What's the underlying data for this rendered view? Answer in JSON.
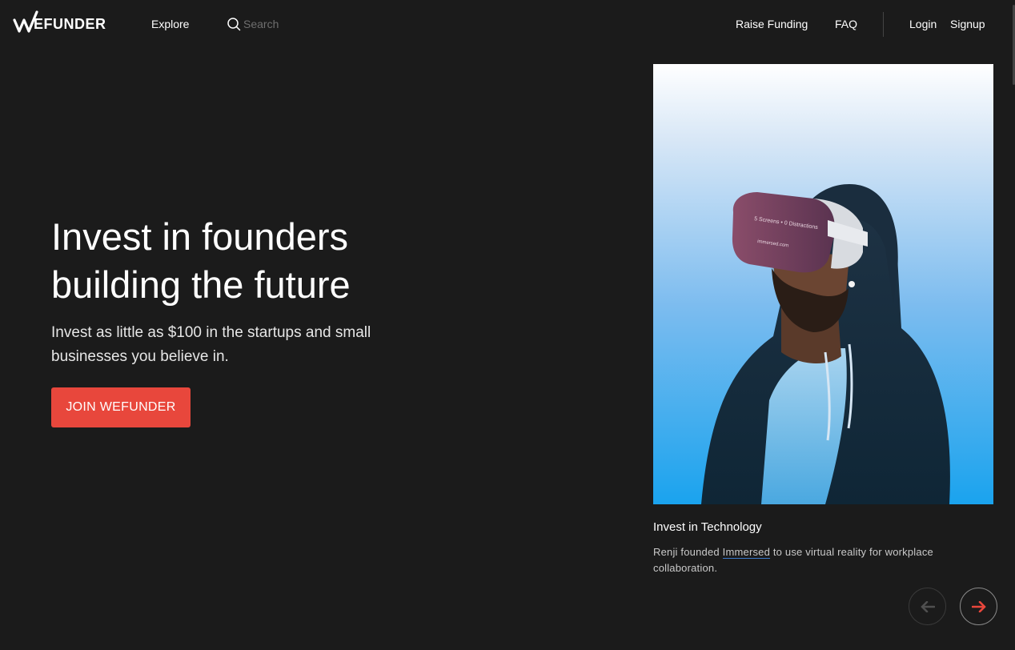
{
  "header": {
    "logo_text": "EFUNDER",
    "nav": {
      "explore": "Explore",
      "raise_funding": "Raise Funding",
      "faq": "FAQ",
      "login": "Login",
      "signup": "Signup"
    },
    "search": {
      "placeholder": "Search"
    }
  },
  "hero": {
    "title_line1": "Invest in founders",
    "title_line2": "building the future",
    "subtitle_line1": "Invest as little as $100 in the startups and small",
    "subtitle_line2": "businesses you believe in.",
    "cta_label": "JOIN WEFUNDER"
  },
  "feature": {
    "title": "Invest in Technology",
    "desc_before": "Renji founded ",
    "desc_link": "Immersed",
    "desc_after": " to use virtual reality for workplace collaboration.",
    "headset_text": "5 Screens • 0 Distractions",
    "headset_brand": "immersed.com"
  },
  "colors": {
    "background": "#1b1b1b",
    "accent": "#e8473c",
    "link_underline": "#3a78c9"
  },
  "icons": {
    "logo": "wefunder-w-icon",
    "search": "search-icon",
    "prev": "arrow-left-icon",
    "next": "arrow-right-icon"
  }
}
